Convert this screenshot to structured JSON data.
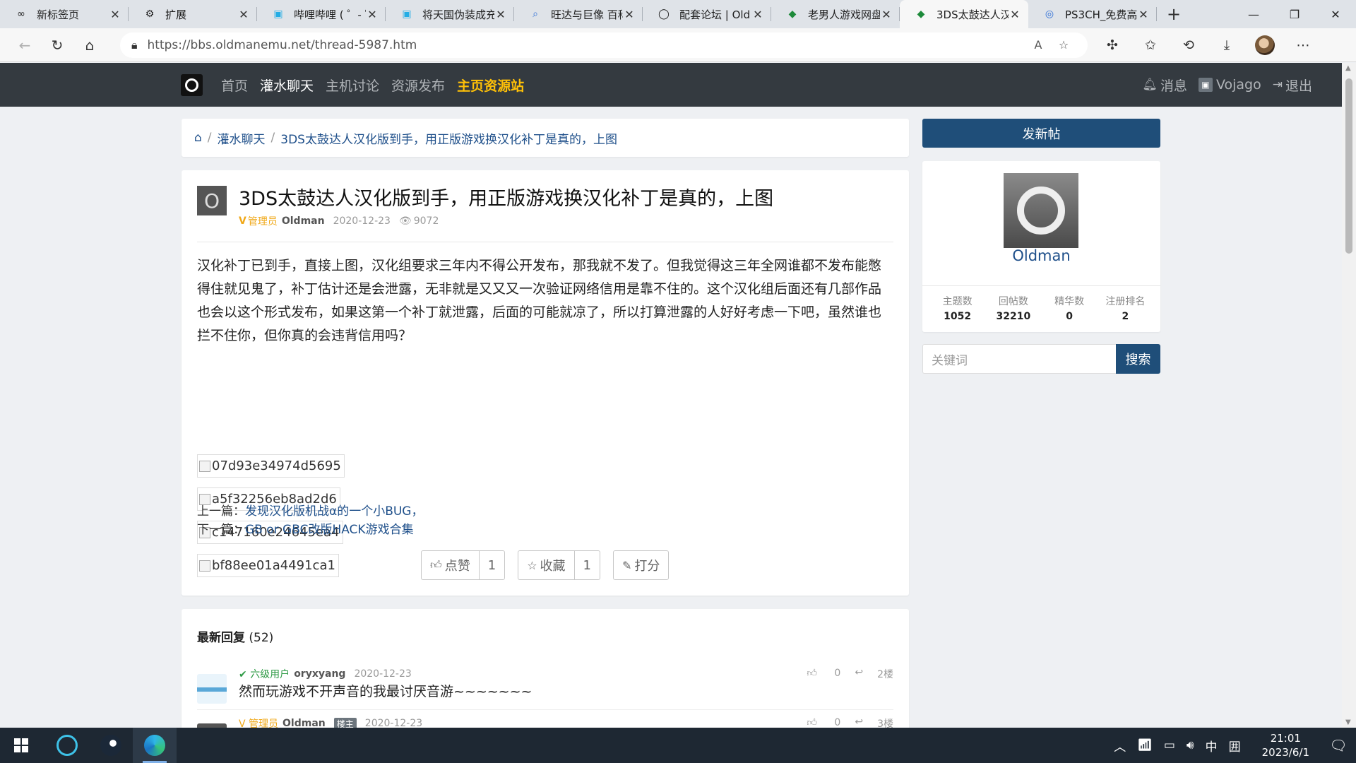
{
  "browser": {
    "tabs": [
      {
        "icon": "∞",
        "title": "新标签页",
        "active": false
      },
      {
        "icon": "⚙",
        "title": "扩展",
        "active": false
      },
      {
        "icon": "▣",
        "title": "哔哩哔哩 ( ゜- ゜",
        "active": false
      },
      {
        "icon": "▣",
        "title": "将天国伪装成充",
        "active": false
      },
      {
        "icon": "⌕",
        "title": "旺达与巨像 百科",
        "active": false
      },
      {
        "icon": "◯",
        "title": "配套论坛 | Old",
        "active": false
      },
      {
        "icon": "◆",
        "title": "老男人游戏网盘",
        "active": false
      },
      {
        "icon": "◆",
        "title": "3DS太鼓达人汉",
        "active": true
      },
      {
        "icon": "◎",
        "title": "PS3CH_免费高",
        "active": false
      }
    ],
    "url": "https://bbs.oldmanemu.net/thread-5987.htm",
    "new_tab": "+",
    "window_controls": {
      "minimize": "—",
      "restore": "❐",
      "close": "✕"
    }
  },
  "site": {
    "menu": [
      {
        "label": "首页",
        "style": "normal"
      },
      {
        "label": "灌水聊天",
        "style": "current"
      },
      {
        "label": "主机讨论",
        "style": "normal"
      },
      {
        "label": "资源发布",
        "style": "normal"
      },
      {
        "label": "主页资源站",
        "style": "highlight"
      }
    ],
    "right": {
      "messages": "消息",
      "user": "Vojago",
      "logout": "退出"
    }
  },
  "breadcrumb": {
    "home_icon": "⌂",
    "section": "灌水聊天",
    "thread": "3DS太鼓达人汉化版到手，用正版游戏换汉化补丁是真的，上图"
  },
  "post": {
    "avatar_letter": "O",
    "title": "3DS太鼓达人汉化版到手，用正版游戏换汉化补丁是真的，上图",
    "role_badge": "V",
    "role": "管理员",
    "author": "Oldman",
    "date": "2020-12-23",
    "views": "9072",
    "body": "汉化补丁已到手，直接上图，汉化组要求三年内不得公开发布，那我就不发了。但我觉得这三年全网谁都不发布能憋得住就见鬼了，补丁估计还是会泄露，无非就是又又又一次验证网络信用是靠不住的。这个汉化组后面还有几部作品也会以这个形式发布，如果这第一个补丁就泄露，后面的可能就凉了，所以打算泄露的人好好考虑一下吧，虽然谁也拦不住你，但你真的会违背信用吗？",
    "images": [
      "07d93e34974d5695",
      "a5f32256eb8ad2d6",
      "c147160e24645ea4",
      "bf88ee01a4491ca1"
    ],
    "prev_label": "上一篇：",
    "prev_title": "发现汉化版机战α的一个小BUG，",
    "next_label": "下一篇：",
    "next_title": "GB or GBC改版HACK游戏合集",
    "like_label": "点赞",
    "like_count": "1",
    "fav_label": "收藏",
    "fav_count": "1",
    "rate_label": "打分"
  },
  "replies": {
    "title": "最新回复",
    "count": "(52)",
    "items": [
      {
        "level": "六级用户",
        "user": "oryxyang",
        "date": "2020-12-23",
        "likes": "0",
        "floor": "2楼",
        "text": "然而玩游戏不开声音的我最讨厌音游~~~~~~~"
      },
      {
        "level": "管理员",
        "user": "Oldman",
        "tag": "楼主",
        "date": "2020-12-23",
        "likes": "0",
        "floor": "3楼",
        "text": ""
      }
    ]
  },
  "sidebar": {
    "new_post": "发新帖",
    "profile_name": "Oldman",
    "stats": [
      {
        "label": "主题数",
        "value": "1052"
      },
      {
        "label": "回帖数",
        "value": "32210"
      },
      {
        "label": "精华数",
        "value": "0"
      },
      {
        "label": "注册排名",
        "value": "2"
      }
    ],
    "search_placeholder": "关键词",
    "search_button": "搜索"
  },
  "taskbar": {
    "ime": "中",
    "ime2": "囲",
    "time": "21:01",
    "date": "2023/6/1"
  }
}
